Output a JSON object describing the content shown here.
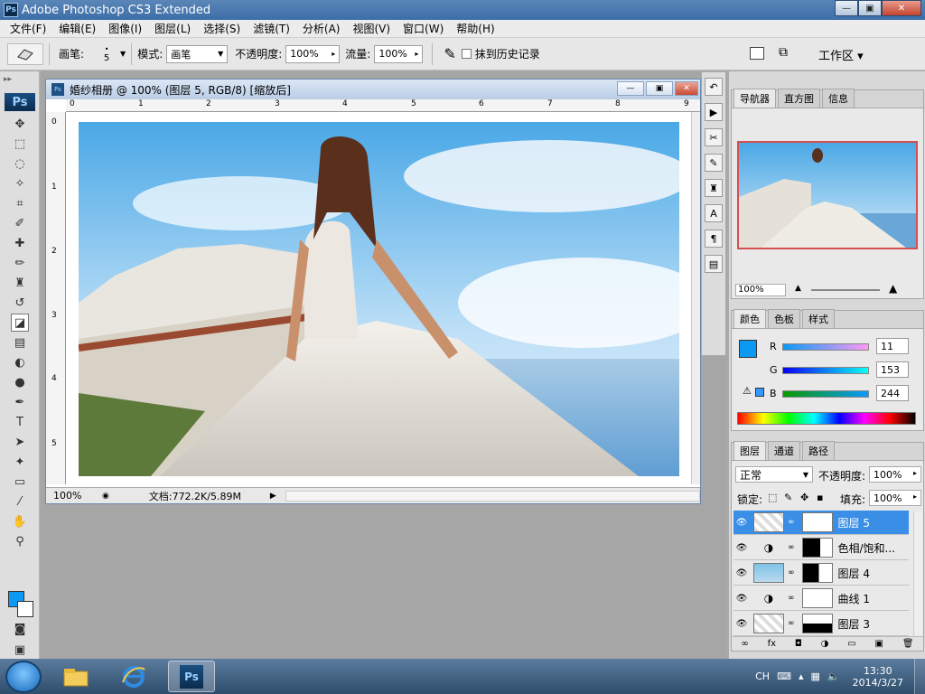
{
  "window": {
    "title": "Adobe Photoshop CS3 Extended",
    "logo_text": "Ps",
    "min": "—",
    "max": "▣",
    "close": "✕"
  },
  "menu": [
    "文件(F)",
    "编辑(E)",
    "图像(I)",
    "图层(L)",
    "选择(S)",
    "滤镜(T)",
    "分析(A)",
    "视图(V)",
    "窗口(W)",
    "帮助(H)"
  ],
  "options": {
    "brush_label": "画笔:",
    "brush_size": "5",
    "mode_label": "模式:",
    "mode_value": "画笔",
    "opacity_label": "不透明度:",
    "opacity_value": "100%",
    "flow_label": "流量:",
    "flow_value": "100%",
    "erase_history": "抹到历史记录",
    "workspace": "工作区 ▾"
  },
  "document": {
    "title": "婚纱相册 @ 100% (图层 5, RGB/8) [缩放后]",
    "zoom": "100%",
    "doc_info": "文档:772.2K/5.89M",
    "ruler_h": [
      "0",
      "1",
      "2",
      "3",
      "4",
      "5",
      "6",
      "7",
      "8",
      "9"
    ],
    "ruler_v": [
      "0",
      "1",
      "2",
      "3",
      "4",
      "5"
    ]
  },
  "navigator": {
    "tabs": [
      "导航器",
      "直方图",
      "信息"
    ],
    "zoom": "100%"
  },
  "color_panel": {
    "tabs": [
      "颜色",
      "色板",
      "样式"
    ],
    "r_label": "R",
    "g_label": "G",
    "b_label": "B",
    "r": "11",
    "g": "153",
    "b": "244",
    "fg_color": "#0b99f4"
  },
  "layers_panel": {
    "tabs": [
      "图层",
      "通道",
      "路径"
    ],
    "blend_mode": "正常",
    "opacity_label": "不透明度:",
    "opacity": "100%",
    "lock_label": "锁定:",
    "fill_label": "填充:",
    "fill": "100%",
    "layers": [
      {
        "name": "图层 5",
        "selected": true
      },
      {
        "name": "色相/饱和...",
        "selected": false
      },
      {
        "name": "图层 4",
        "selected": false
      },
      {
        "name": "曲线 1",
        "selected": false
      },
      {
        "name": "图层 3",
        "selected": false
      }
    ]
  },
  "taskbar": {
    "lang": "CH",
    "time": "13:30",
    "date": "2014/3/27"
  }
}
